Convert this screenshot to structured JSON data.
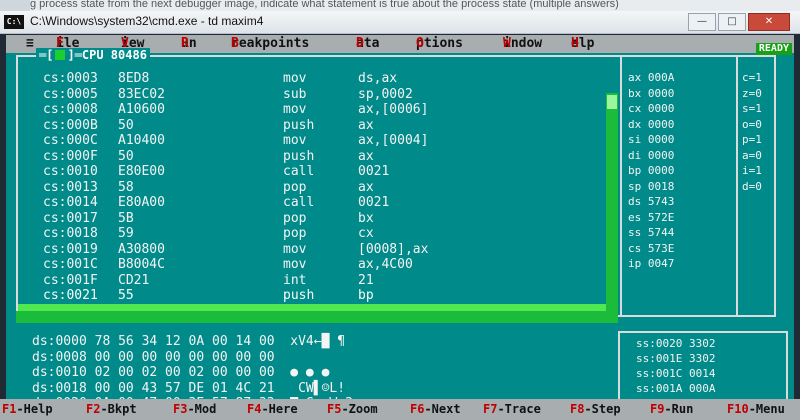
{
  "caption": "g process state from the next debugger image, indicate what statement is true about the process state (multiple answers)",
  "window": {
    "title": "C:\\Windows\\system32\\cmd.exe - td  maxim4",
    "icon": "C:\\"
  },
  "menu": [
    {
      "hot": "F",
      "rest": "ile"
    },
    {
      "hot": "V",
      "rest": "iew"
    },
    {
      "hot": "R",
      "rest": "un"
    },
    {
      "hot": "B",
      "rest": "reakpoints"
    },
    {
      "hot": "D",
      "rest": "ata"
    },
    {
      "hot": "O",
      "rest": "ptions"
    },
    {
      "hot": "W",
      "rest": "indow"
    },
    {
      "hot": "H",
      "rest": "elp"
    }
  ],
  "ready_label": "READY",
  "cpu_title": "CPU 80486",
  "disasm": [
    {
      "addr": "cs:0003",
      "bytes": "8ED8",
      "mn": "mov",
      "op": "ds,ax"
    },
    {
      "addr": "cs:0005",
      "bytes": "83EC02",
      "mn": "sub",
      "op": "sp,0002"
    },
    {
      "addr": "cs:0008",
      "bytes": "A10600",
      "mn": "mov",
      "op": "ax,[0006]"
    },
    {
      "addr": "cs:000B",
      "bytes": "50",
      "mn": "push",
      "op": "ax"
    },
    {
      "addr": "cs:000C",
      "bytes": "A10400",
      "mn": "mov",
      "op": "ax,[0004]"
    },
    {
      "addr": "cs:000F",
      "bytes": "50",
      "mn": "push",
      "op": "ax"
    },
    {
      "addr": "cs:0010",
      "bytes": "E80E00",
      "mn": "call",
      "op": "0021"
    },
    {
      "addr": "cs:0013",
      "bytes": "58",
      "mn": "pop",
      "op": "ax"
    },
    {
      "addr": "cs:0014",
      "bytes": "E80A00",
      "mn": "call",
      "op": "0021"
    },
    {
      "addr": "cs:0017",
      "bytes": "5B",
      "mn": "pop",
      "op": "bx"
    },
    {
      "addr": "cs:0018",
      "bytes": "59",
      "mn": "pop",
      "op": "cx"
    },
    {
      "addr": "cs:0019",
      "bytes": "A30800",
      "mn": "mov",
      "op": "[0008],ax"
    },
    {
      "addr": "cs:001C",
      "bytes": "B8004C",
      "mn": "mov",
      "op": "ax,4C00"
    },
    {
      "addr": "cs:001F",
      "bytes": "CD21",
      "mn": "int",
      "op": "21"
    },
    {
      "addr": "cs:0021",
      "bytes": "55",
      "mn": "push",
      "op": "bp"
    }
  ],
  "registers": [
    "ax 000A",
    "bx 0000",
    "cx 0000",
    "dx 0000",
    "si 0000",
    "di 0000",
    "bp 0000",
    "sp 0018",
    "ds 5743",
    "es 572E",
    "ss 5744",
    "cs 573E",
    "ip 0047"
  ],
  "flags": [
    "c=1",
    "z=0",
    "s=1",
    "o=0",
    "p=1",
    "a=0",
    "i=1",
    "d=0"
  ],
  "dump": [
    "ds:0000 78 56 34 12 0A 00 14 00  xV4←█ ¶",
    "ds:0008 00 00 00 00 00 00 00 00",
    "ds:0010 02 00 02 00 02 00 00 00  ● ● ●",
    "ds:0018 00 00 43 57 DE 01 4C 21   CW▌☺L!",
    "ds:0020 0A 00 47 00 3E 57 87 33  ◙ G >Wç3"
  ],
  "stack": [
    "ss:0020 3302",
    "ss:001E 3302",
    "ss:001C 0014",
    "ss:001A 000A",
    "ss:0018►0013"
  ],
  "fkeys": [
    {
      "key": "F1",
      "label": "-Help"
    },
    {
      "key": "F2",
      "label": "-Bkpt"
    },
    {
      "key": "F3",
      "label": "-Mod"
    },
    {
      "key": "F4",
      "label": "-Here"
    },
    {
      "key": "F5",
      "label": "-Zoom"
    },
    {
      "key": "F6",
      "label": "-Next"
    },
    {
      "key": "F7",
      "label": "-Trace"
    },
    {
      "key": "F8",
      "label": "-Step"
    },
    {
      "key": "F9",
      "label": "-Run"
    },
    {
      "key": "F10",
      "label": "-Menu"
    }
  ]
}
